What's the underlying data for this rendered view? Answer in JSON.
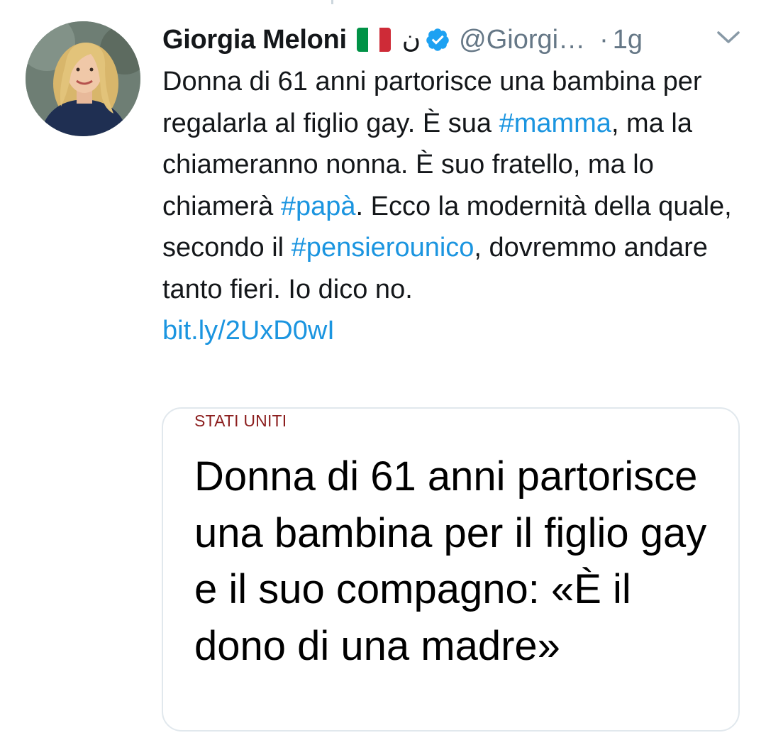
{
  "tweet": {
    "author": {
      "name": "Giorgia Meloni",
      "arabic_char": "ن",
      "handle": "@Giorgi…",
      "verified": true
    },
    "separator": "·",
    "time": "1g",
    "text_segments": [
      {
        "text": "Donna di 61 anni partorisce una bambina per regalarla al figlio gay. È sua ",
        "type": "text"
      },
      {
        "text": "#mamma",
        "type": "hashtag"
      },
      {
        "text": ", ma la chiameranno nonna. È suo fratello, ma lo chiamerà ",
        "type": "text"
      },
      {
        "text": "#papà",
        "type": "hashtag"
      },
      {
        "text": ". Ecco la modernità della quale, secondo il ",
        "type": "text"
      },
      {
        "text": "#pensierounico",
        "type": "hashtag"
      },
      {
        "text": ", dovremmo andare tanto fieri. Io dico no.",
        "type": "text"
      }
    ],
    "link": "bit.ly/2UxD0wI",
    "card": {
      "category": "STATI UNITI",
      "title": "Donna di 61 anni partorisce una bambina per il figlio gay e il suo compagno: «È il dono di una madre»"
    }
  },
  "colors": {
    "link": "#1b95e0",
    "muted": "#657786",
    "text": "#14171a",
    "verified": "#1da1f2",
    "category": "#8b1d1d",
    "border": "#e1e8ed"
  },
  "icons": {
    "flag": "italy-flag-icon",
    "verified": "verified-badge-icon",
    "menu": "chevron-down-icon"
  }
}
